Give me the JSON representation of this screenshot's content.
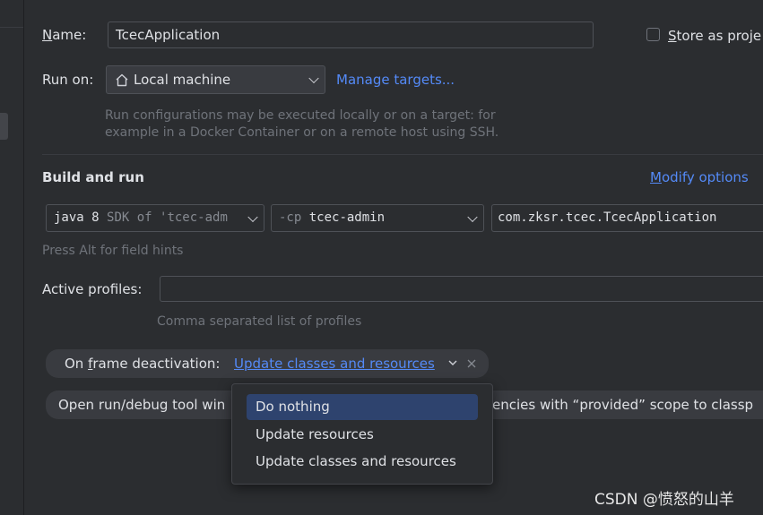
{
  "name": {
    "label_mnemonic": "N",
    "label_rest": "ame:",
    "value": "TcecApplication"
  },
  "store": {
    "mnemonic": "S",
    "rest": "tore as proje",
    "checked": false
  },
  "run_on": {
    "label": "Run on:",
    "target": "Local machine",
    "manage_link": "Manage targets...",
    "hint_line1": "Run configurations may be executed locally or on a target: for",
    "hint_line2": "example in a Docker Container or on a remote host using SSH."
  },
  "build": {
    "title": "Build and run",
    "modify_mnemonic": "M",
    "modify_rest": "odify options",
    "jdk": {
      "strong": "java 8",
      "dim": "SDK of 'tcec-adm"
    },
    "classpath": {
      "prefix": "-cp",
      "module": "tcec-admin"
    },
    "main_class": "com.zksr.tcec.TcecApplication",
    "hint": "Press Alt for field hints"
  },
  "profiles": {
    "label": "Active profiles:",
    "value": "",
    "hint": "Comma separated list of profiles"
  },
  "frame_deactivation": {
    "prefix": "On ",
    "mnemonic": "f",
    "label_rest": "rame deactivation:",
    "value": "Update classes and resources"
  },
  "second_row": {
    "left_text": "Open run/debug tool win",
    "right_text": "encies with “provided” scope to classp"
  },
  "dropdown": {
    "options": [
      "Do nothing",
      "Update resources",
      "Update classes and resources"
    ],
    "selected_index": 0
  },
  "watermark": "CSDN @愤怒的山羊",
  "colors": {
    "accent": "#548af7",
    "selection": "#2e436e",
    "background": "#2b2d30"
  }
}
